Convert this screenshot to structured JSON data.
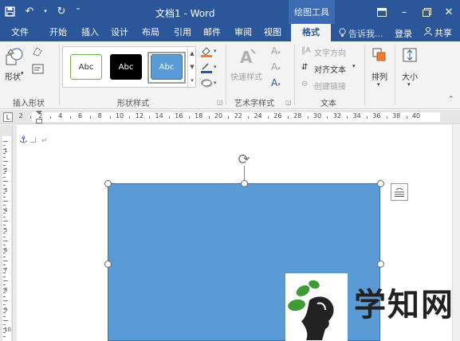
{
  "titlebar": {
    "title": "文档1 - Word",
    "contextual_tab": "绘图工具",
    "qat_icons": [
      "save-icon",
      "undo-icon",
      "redo-icon",
      "customize-icon"
    ],
    "window_icons": [
      "ribbon-display-icon",
      "minimize-icon",
      "restore-icon",
      "close-icon"
    ]
  },
  "tabs": [
    "文件",
    "开始",
    "插入",
    "设计",
    "布局",
    "引用",
    "邮件",
    "审阅",
    "视图",
    "格式"
  ],
  "active_tab": "格式",
  "tell_me": "告诉我...",
  "sign_in": "登录",
  "share": "共享",
  "ribbon": {
    "insert_shapes": {
      "label": "插入形状",
      "shapes_button": "形状"
    },
    "shape_styles": {
      "label": "形状样式",
      "samples": [
        {
          "text": "Abc",
          "fill": "#ffffff",
          "border": "#70ad47",
          "color": "#333333"
        },
        {
          "text": "Abc",
          "fill": "#000000",
          "border": "#000000",
          "color": "#ffffff"
        },
        {
          "text": "Abc",
          "fill": "#5b9bd5",
          "border": "#41719c",
          "color": "#ffffff"
        }
      ]
    },
    "wordart": {
      "label": "艺术字样式",
      "quick_styles": "快速样式"
    },
    "text": {
      "label": "文本",
      "direction": "文字方向",
      "align": "对齐文本",
      "link": "创建链接"
    },
    "arrange": {
      "label": "排列"
    },
    "size": {
      "label": "大小"
    }
  },
  "ruler": {
    "labels": [
      "2",
      "2",
      "4",
      "6",
      "8",
      "10",
      "12",
      "14",
      "16",
      "18",
      "20",
      "22",
      "24",
      "26",
      "28",
      "30",
      "32",
      "34",
      "36",
      "38",
      "40"
    ],
    "corner": "L"
  },
  "vruler": {
    "labels": [
      "1",
      "2",
      "3",
      "4",
      "5",
      "6",
      "7",
      "8",
      "9",
      "10"
    ]
  },
  "document": {
    "shape_color": "#5b9bd5",
    "shape_border": "#41719c",
    "paragraph_mark": "↵"
  },
  "watermark": {
    "text": "学知网"
  },
  "colors": {
    "accent": "#2b579a",
    "ribbon_bg": "#f3f3f3"
  }
}
